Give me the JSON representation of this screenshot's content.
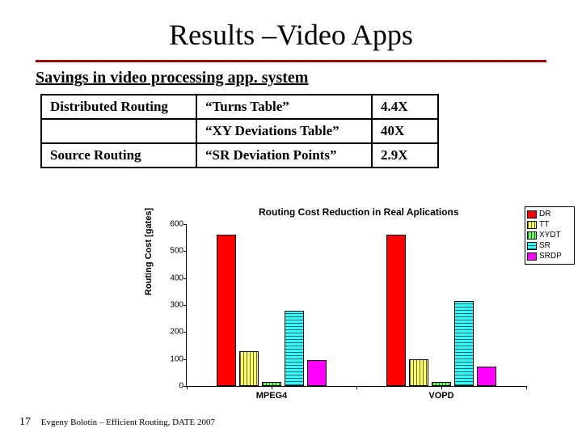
{
  "title": "Results –Video Apps",
  "subtitle": "Savings in video processing app. system",
  "table": {
    "rows": [
      {
        "c1": "Distributed Routing",
        "c2": "“Turns Table”",
        "c3": "4.4X"
      },
      {
        "c1": "",
        "c2": "“XY Deviations Table”",
        "c3": "40X"
      },
      {
        "c1": "Source Routing",
        "c2": "“SR Deviation Points”",
        "c3": "2.9X"
      }
    ]
  },
  "chart_data": {
    "type": "bar",
    "title": "Routing Cost Reduction in Real Aplications",
    "ylabel": "Routing Cost [gates]",
    "ylim": [
      0,
      600
    ],
    "yticks": [
      0,
      100,
      200,
      300,
      400,
      500,
      600
    ],
    "categories": [
      "MPEG4",
      "VOPD"
    ],
    "series": [
      {
        "name": "DR",
        "color": "#ff0000",
        "hatch": "",
        "values": [
          560,
          560
        ]
      },
      {
        "name": "TT",
        "color": "#ffff66",
        "hatch": "hatch-y",
        "values": [
          128,
          100
        ]
      },
      {
        "name": "XYDT",
        "color": "#66ff66",
        "hatch": "hatch-g",
        "values": [
          14,
          14
        ]
      },
      {
        "name": "SR",
        "color": "#33ffff",
        "hatch": "hatch-c",
        "values": [
          280,
          315
        ]
      },
      {
        "name": "SRDP",
        "color": "#ff00ff",
        "hatch": "",
        "values": [
          96,
          72
        ]
      }
    ]
  },
  "footer": {
    "page": "17",
    "text": "Evgeny Bolotin – Efficient Routing, DATE 2007"
  }
}
